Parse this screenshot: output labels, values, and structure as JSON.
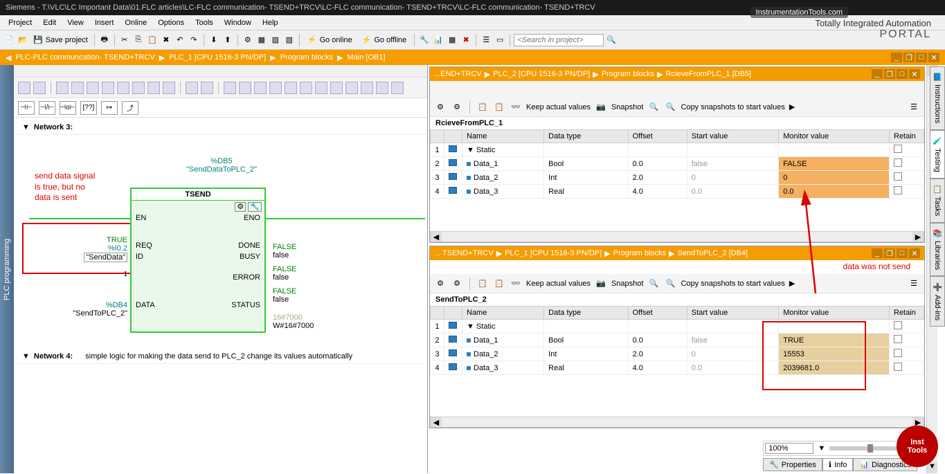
{
  "title_bar": "Siemens - T.\\VLC\\LC Important Data\\01.FLC articles\\LC-FLC communication- TSEND+TRCV\\LC-FLC communication- TSEND+TRCV\\LC-FLC communication- TSEND+TRCV",
  "watermark": "InstrumentationTools.com",
  "menu": [
    "Project",
    "Edit",
    "View",
    "Insert",
    "Online",
    "Options",
    "Tools",
    "Window",
    "Help"
  ],
  "toolbar": {
    "save": "Save project",
    "go_online": "Go online",
    "go_offline": "Go offline",
    "search_ph": "<Search in project>"
  },
  "brand": {
    "line1": "Totally Integrated Automation",
    "line2": "PORTAL"
  },
  "breadcrumb": [
    "PLC-PLC communcation- TSEND+TRCV",
    "PLC_1 [CPU 1516-3 PN/DP]",
    "Program blocks",
    "Main [OB1]"
  ],
  "side_tab": "PLC programming",
  "lad_icons": [
    "⊣⊢",
    "⊣/⊢",
    "⊣o⊢",
    "[??]",
    "↦",
    "⤴"
  ],
  "network3": {
    "title": "Network 3:",
    "db5": "%DB5",
    "db5_name": "\"SendDataToPLC_2\"",
    "block_title": "TSEND",
    "annot": "send data signal\nis true, but no\ndata is sent",
    "en": "EN",
    "eno": "ENO",
    "req": "REQ",
    "id": "ID",
    "data": "DATA",
    "done": "DONE",
    "busy": "BUSY",
    "error": "ERROR",
    "status": "STATUS",
    "req_val": "TRUE",
    "req_addr": "%I0.2",
    "req_name": "\"SendData\"",
    "id_val": "1",
    "data_db": "%DB4",
    "data_name": "\"SendToPLC_2\"",
    "done_val": "FALSE",
    "done_txt": "false",
    "busy_val": "FALSE",
    "busy_txt": "false",
    "error_val": "FALSE",
    "error_txt": "false",
    "status_hex": "16#7000",
    "status_txt": "W#16#7000"
  },
  "network4": {
    "title": "Network 4:",
    "desc": "simple logic for making the data send to PLC_2 change its values automatically"
  },
  "db_top": {
    "bc": [
      "...END+TRCV",
      "PLC_2 [CPU 1516-3 PN/DP]",
      "Program blocks",
      "RcieveFromPLC_1 [DB5]"
    ],
    "actions": {
      "keep": "Keep actual values",
      "snap": "Snapshot",
      "copy": "Copy snapshots to start values"
    },
    "name": "RcieveFromPLC_1",
    "cols": [
      "",
      "Name",
      "Data type",
      "Offset",
      "Start value",
      "Monitor value",
      "Retain"
    ],
    "static": "Static",
    "rows": [
      {
        "n": "Data_1",
        "dt": "Bool",
        "off": "0.0",
        "sv": "false",
        "mv": "FALSE"
      },
      {
        "n": "Data_2",
        "dt": "Int",
        "off": "2.0",
        "sv": "0",
        "mv": "0"
      },
      {
        "n": "Data_3",
        "dt": "Real",
        "off": "4.0",
        "sv": "0.0",
        "mv": "0.0"
      }
    ]
  },
  "db_bot": {
    "bc": [
      "... TSEND+TRCV",
      "PLC_1 [CPU 1516-3 PN/DP]",
      "Program blocks",
      "SendToPLC_2 [DB4]"
    ],
    "annot": "data was not send",
    "actions": {
      "keep": "Keep actual values",
      "snap": "Snapshot",
      "copy": "Copy snapshots to start values"
    },
    "name": "SendToPLC_2",
    "cols": [
      "",
      "Name",
      "Data type",
      "Offset",
      "Start value",
      "Monitor value",
      "Retain"
    ],
    "static": "Static",
    "rows": [
      {
        "n": "Data_1",
        "dt": "Bool",
        "off": "0.0",
        "sv": "false",
        "mv": "TRUE"
      },
      {
        "n": "Data_2",
        "dt": "Int",
        "off": "2.0",
        "sv": "0",
        "mv": "15553"
      },
      {
        "n": "Data_3",
        "dt": "Real",
        "off": "4.0",
        "sv": "0.0",
        "mv": "2039681.0"
      }
    ]
  },
  "right_tabs": [
    "Instructions",
    "Testing",
    "Tasks",
    "Libraries",
    "Add-ins"
  ],
  "zoom": "100%",
  "status": [
    "Properties",
    "Info",
    "Diagnostics"
  ],
  "inst_circle": "Inst\nTools"
}
